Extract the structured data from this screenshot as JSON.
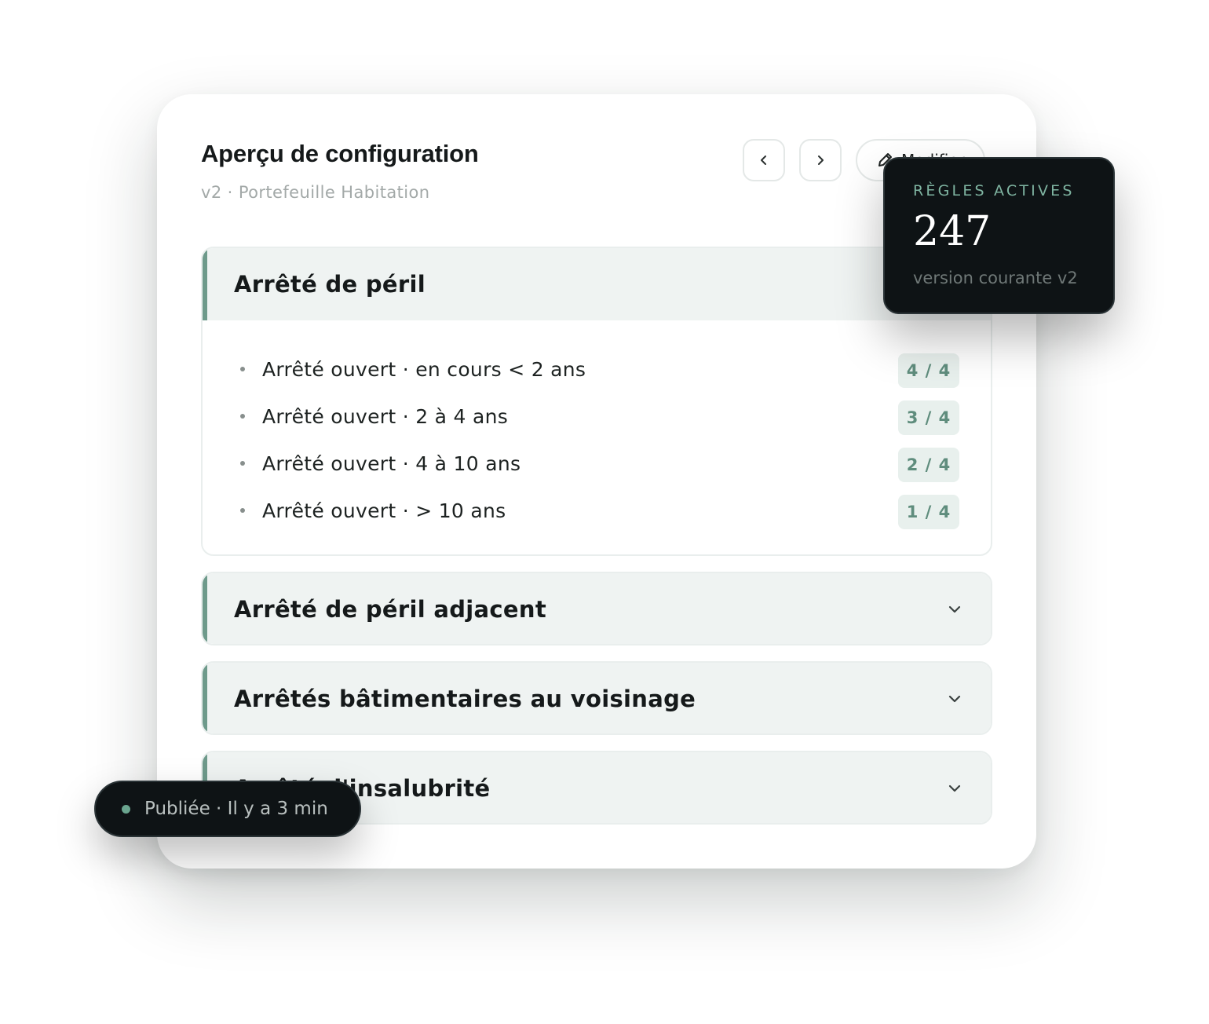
{
  "card": {
    "title": "Aperçu de configuration",
    "subtitle": "v2 · Portefeuille Habitation",
    "toolbar": {
      "prev_icon": "chevron-left-icon",
      "next_icon": "chevron-right-icon",
      "edit_icon": "pencil-icon",
      "edit_label": "Modifier"
    }
  },
  "sections": [
    {
      "title": "Arrêté de péril",
      "expanded": true,
      "rules": [
        {
          "label": "Arrêté ouvert · en cours < 2 ans",
          "badge": "4 / 4"
        },
        {
          "label": "Arrêté ouvert · 2 à 4 ans",
          "badge": "3 / 4"
        },
        {
          "label": "Arrêté ouvert · 4 à 10 ans",
          "badge": "2 / 4"
        },
        {
          "label": "Arrêté ouvert · > 10 ans",
          "badge": "1 / 4"
        }
      ]
    },
    {
      "title": "Arrêté de péril adjacent",
      "expanded": false
    },
    {
      "title": "Arrêtés bâtimentaires au voisinage",
      "expanded": false
    },
    {
      "title": "Arrêté d'insalubrité",
      "expanded": false
    }
  ],
  "stats": {
    "label": "RÈGLES ACTIVES",
    "value": "247",
    "caption": "version courante v2"
  },
  "status": {
    "text": "Publiée · Il y a 3 min",
    "color": "#6aa58f"
  },
  "colors": {
    "accent": "#6e9a8b",
    "badge_text": "#5f8d7d",
    "dark_surface": "#0e1315"
  }
}
